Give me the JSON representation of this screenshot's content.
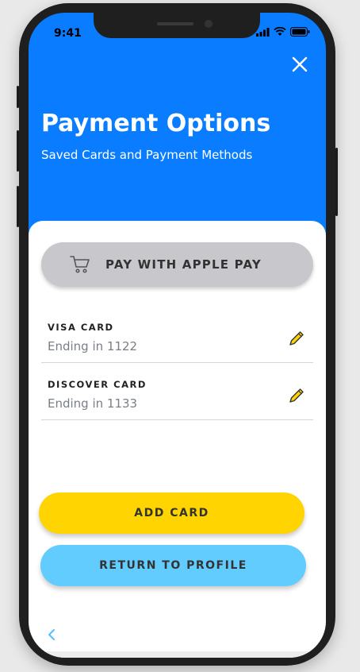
{
  "status_bar": {
    "time": "9:41"
  },
  "header": {
    "title": "Payment Options",
    "subtitle": "Saved Cards and Payment Methods"
  },
  "apple_pay": {
    "label": "PAY WITH APPLE PAY"
  },
  "cards": [
    {
      "name": "VISA CARD",
      "ending": "Ending in 1122"
    },
    {
      "name": "DISCOVER CARD",
      "ending": "Ending in 1133"
    }
  ],
  "actions": {
    "add_card": "ADD CARD",
    "return_to_profile": "RETURN TO PROFILE"
  },
  "colors": {
    "header_blue": "#0a7cff",
    "add_card_yellow": "#ffd400",
    "return_blue": "#62ccff",
    "apple_pay_gray": "#c8c8cc"
  },
  "icons": [
    "signal-icon",
    "wifi-icon",
    "battery-icon",
    "close-icon",
    "cart-icon",
    "pencil-icon",
    "chevron-left-icon"
  ]
}
